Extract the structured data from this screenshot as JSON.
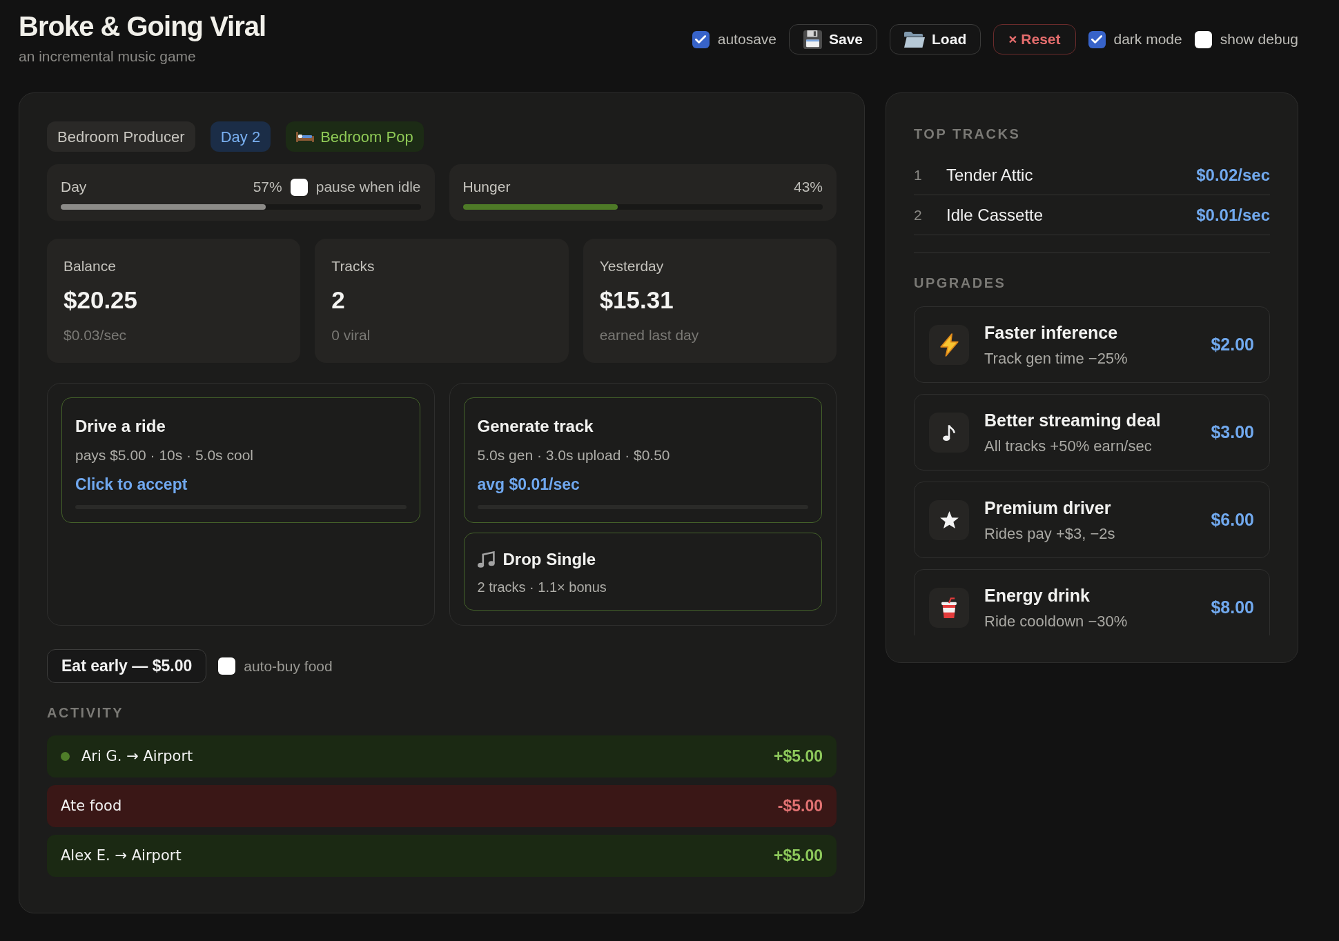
{
  "header": {
    "title": "Broke & Going Viral",
    "subtitle": "an incremental music game"
  },
  "toolbar": [
    {
      "kind": "checkbox",
      "label": "autosave",
      "checked": true
    },
    {
      "kind": "button",
      "label": "Save"
    },
    {
      "kind": "button",
      "label": "Load"
    },
    {
      "kind": "danger",
      "label": "× Reset"
    },
    {
      "kind": "checkbox",
      "label": "dark mode",
      "checked": true
    },
    {
      "kind": "checkbox",
      "label": "show debug",
      "checked": false
    }
  ],
  "badges": [
    {
      "kind": "role",
      "label": "Bedroom Producer"
    },
    {
      "kind": "day",
      "label": "Day 2"
    },
    {
      "kind": "genre",
      "label": "Bedroom Pop"
    }
  ],
  "meters": [
    {
      "label": "Day",
      "reading": "57%",
      "level": 0.57,
      "color": "#8c8b88",
      "toggle": {
        "label": "pause when idle",
        "checked": false
      }
    },
    {
      "label": "Hunger",
      "reading": "43%",
      "level": 0.43,
      "color": "#4e7a27"
    }
  ],
  "stats": [
    {
      "label": "Balance",
      "value": "$20.25",
      "note": "$0.03/sec"
    },
    {
      "label": "Tracks",
      "value": "2",
      "note": "0 viral"
    },
    {
      "label": "Yesterday",
      "value": "$15.31",
      "note": "earned last day"
    }
  ],
  "actions": [
    {
      "cards": [
        {
          "kind": "task",
          "title": "Drive a ride",
          "detail": "pays $5.00 · 10s · 5.0s cool",
          "status": "Click to accept",
          "level": 0
        }
      ]
    },
    {
      "cards": [
        {
          "kind": "task",
          "title": "Generate track",
          "detail": "5.0s gen · 3.0s upload · $0.50",
          "status": "avg $0.01/sec",
          "level": 0
        },
        {
          "kind": "release",
          "title": "Drop Single",
          "detail": "2 tracks · 1.1× bonus"
        }
      ]
    }
  ],
  "food": {
    "button": "Eat early — $5.00",
    "auto_buy": {
      "label": "auto-buy food",
      "checked": false
    }
  },
  "activity": {
    "title": "ACTIVITY",
    "rows": [
      {
        "kind": "income",
        "text": "Ari G. → Airport",
        "amount": "+$5.00",
        "latest": true
      },
      {
        "kind": "expense",
        "text": "Ate food",
        "amount": "-$5.00",
        "latest": false
      },
      {
        "kind": "income",
        "text": "Alex E. → Airport",
        "amount": "+$5.00",
        "latest": false
      }
    ]
  },
  "top_tracks": {
    "title": "TOP TRACKS",
    "rows": [
      {
        "rank": "1",
        "name": "Tender Attic",
        "rate": "$0.02/sec"
      },
      {
        "rank": "2",
        "name": "Idle Cassette",
        "rate": "$0.01/sec"
      }
    ]
  },
  "upgrades": {
    "title": "UPGRADES",
    "items": [
      {
        "title": "Faster inference",
        "description": "Track gen time −25%",
        "price": "$2.00"
      },
      {
        "title": "Better streaming deal",
        "description": "All tracks +50% earn/sec",
        "price": "$3.00"
      },
      {
        "title": "Premium driver",
        "description": "Rides pay +$3, −2s",
        "price": "$6.00"
      },
      {
        "title": "Energy drink",
        "description": "Ride cooldown −30%",
        "price": "$8.00"
      }
    ]
  }
}
